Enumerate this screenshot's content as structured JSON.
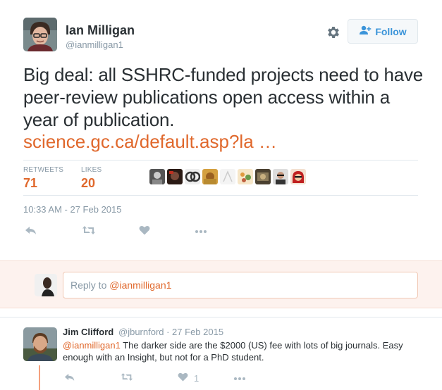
{
  "tweet": {
    "author_name": "Ian Milligan",
    "author_handle": "@ianmilligan1",
    "follow_label": "Follow",
    "text": "Big deal: all SSHRC-funded projects need to have peer-review publications open access within a year of publication.",
    "link": "science.gc.ca/default.asp?la …",
    "retweets_label": "RETWEETS",
    "retweets_count": "71",
    "likes_label": "LIKES",
    "likes_count": "20",
    "timestamp": "10:33 AM - 27 Feb 2015"
  },
  "reply_box": {
    "prefix": "Reply to ",
    "mention": "@ianmilligan1"
  },
  "reply": {
    "author_name": "Jim Clifford",
    "meta": "@jburnford · 27 Feb 2015",
    "mention": "@ianmilligan1",
    "text": " The darker side are the $2000 (US) fee with lots of big journals. Easy enough with an Insight, but not for a PhD student.",
    "like_count": "1"
  },
  "colors": {
    "accent": "#e0682c",
    "follow_blue": "#3b94d9",
    "muted": "#8899a6",
    "icon_gray": "#aab8c2",
    "reply_bar_bg": "#fdf2ee"
  },
  "icons": {
    "settings": "gear-icon",
    "follow": "add-user-icon",
    "reply": "reply-arrow-icon",
    "retweet": "retweet-icon",
    "like": "heart-icon",
    "more": "more-dots-icon"
  }
}
